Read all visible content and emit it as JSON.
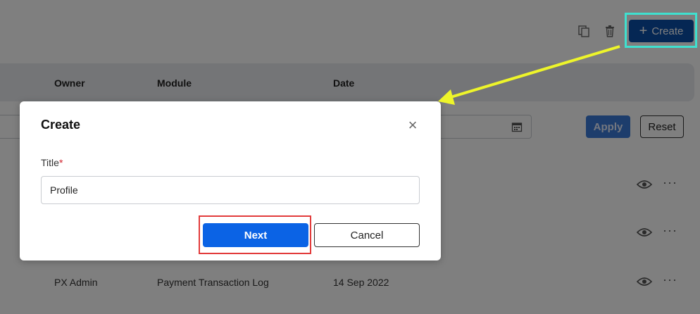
{
  "toolbar": {
    "create_label": "Create",
    "create_plus": "+",
    "copy_icon": "copy-icon",
    "delete_icon": "trash-icon"
  },
  "table": {
    "columns": [
      "Owner",
      "Module",
      "Date"
    ],
    "rows": [
      {
        "owner": "",
        "module": "",
        "date": ""
      },
      {
        "owner": "",
        "module": "",
        "date": ""
      },
      {
        "owner": "PX Admin",
        "module": "Payment Transaction Log",
        "date": "14 Sep 2022"
      }
    ]
  },
  "filters": {
    "apply_label": "Apply",
    "reset_label": "Reset",
    "calendar_icon": "calendar-icon"
  },
  "modal": {
    "title": "Create",
    "field_label": "Title",
    "required_mark": "*",
    "title_value": "Profile",
    "next_label": "Next",
    "cancel_label": "Cancel",
    "close_icon": "close-icon"
  },
  "annotations": {
    "create_highlight_color": "#3fe0cf",
    "next_highlight_color": "#e23b3b",
    "arrow_color": "#eef52a"
  },
  "colors": {
    "primary": "#0b63e5",
    "overlay": "rgba(0,0,0,0.5)"
  }
}
